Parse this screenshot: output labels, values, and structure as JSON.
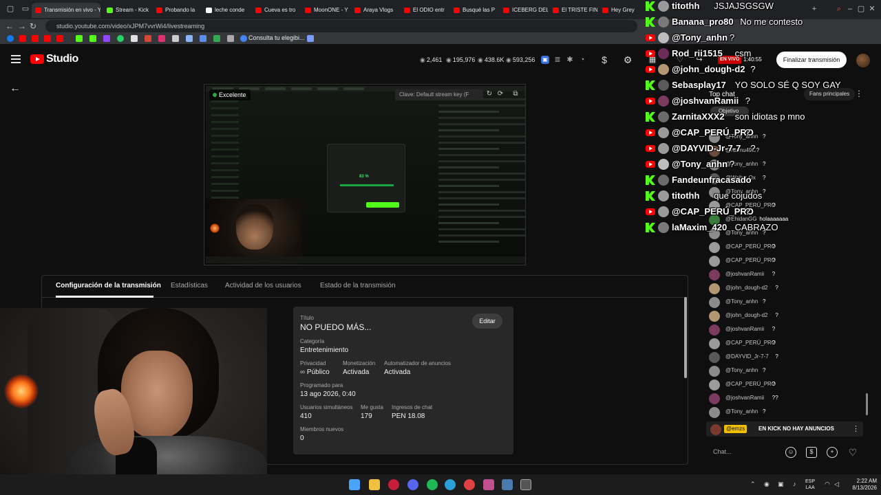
{
  "browser": {
    "tabs": [
      {
        "label": "Transmisión en vivo - Y",
        "active": true,
        "fav_color": "#ff0000"
      },
      {
        "label": "Stream - Kick",
        "active": false,
        "fav_color": "#53fc18"
      },
      {
        "label": "Probando la",
        "active": false,
        "fav_color": "#ff0000"
      },
      {
        "label": "leche conde",
        "active": false,
        "fav_color": "#ffffff"
      },
      {
        "label": "Cueva es tro",
        "active": false,
        "fav_color": "#ff0000"
      },
      {
        "label": "MoonONE - Y",
        "active": false,
        "fav_color": "#ff0000"
      },
      {
        "label": "Araya Vlogs",
        "active": false,
        "fav_color": "#ff0000"
      },
      {
        "label": "El ODIO entr",
        "active": false,
        "fav_color": "#ff0000"
      },
      {
        "label": "Busqué las P",
        "active": false,
        "fav_color": "#ff0000"
      },
      {
        "label": "ICEBERG DEL",
        "active": false,
        "fav_color": "#ff0000"
      },
      {
        "label": "El TRISTE FIN",
        "active": false,
        "fav_color": "#ff0000"
      },
      {
        "label": "Hey Grey",
        "active": false,
        "fav_color": "#ff0000"
      }
    ],
    "url": "studio.youtube.com/video/xJPM7vvrWi4/livestreaming",
    "bookmark_text": "Consulta tu elegibi..."
  },
  "header": {
    "brand": "Studio",
    "stats": [
      {
        "icon": "eye-icon",
        "value": "2,461"
      },
      {
        "icon": "eye-icon",
        "value": "195,976"
      },
      {
        "icon": "eye-icon",
        "value": "438.6K"
      },
      {
        "icon": "eye-icon",
        "value": "593,256"
      }
    ],
    "live_label": "EN VIVO",
    "live_time": "1:40:55",
    "end_button": "Finalizar transmisión"
  },
  "preview": {
    "quality": "Excelente",
    "stream_key": "Clave: Default stream key (F",
    "mini_percent": "83 %"
  },
  "tabs": [
    {
      "label": "Configuración de la transmisión",
      "active": true
    },
    {
      "label": "Estadísticas",
      "active": false
    },
    {
      "label": "Actividad de los usuarios",
      "active": false
    },
    {
      "label": "Estado de la transmisión",
      "active": false
    }
  ],
  "details": {
    "title_label": "Título",
    "title": "NO PUEDO MÁS...",
    "edit_button": "Editar",
    "category_label": "Categoría",
    "category": "Entretenimiento",
    "privacy_label": "Privacidad",
    "privacy": "Público",
    "monetization_label": "Monetización",
    "monetization": "Activada",
    "ads_label": "Automatizador de anuncios",
    "ads": "Activada",
    "scheduled_label": "Programado para",
    "scheduled": "13 ago 2026, 0:40",
    "concurrent_label": "Usuarios simultáneos",
    "concurrent": "410",
    "likes_label": "Me gusta",
    "likes": "179",
    "chat_income_label": "Ingresos de chat",
    "chat_income": "PEN 18.08",
    "new_members_label": "Miembros nuevos",
    "new_members": "0"
  },
  "chat": {
    "header": "Top chat",
    "fans_label": "Fans principales",
    "goal_label": "Objetivo",
    "messages": [
      {
        "name": "@Tony_anhn",
        "msg": "?"
      },
      {
        "name": "@Namu49C",
        "msg": "?"
      },
      {
        "name": "@Tony_anhn",
        "msg": "?"
      },
      {
        "name": "@Walter-Ox",
        "msg": "?"
      },
      {
        "name": "@Tony_anhn",
        "msg": "?"
      },
      {
        "name": "@CAP_PERÚ_PRO",
        "msg": "?"
      },
      {
        "name": "@EhidanGG",
        "msg": "holaaaaaaa"
      },
      {
        "name": "@Tony_anhn",
        "msg": "?"
      },
      {
        "name": "@CAP_PERÚ_PRO",
        "msg": "?"
      },
      {
        "name": "@CAP_PERÚ_PRO",
        "msg": "?"
      },
      {
        "name": "@joshvanRamii",
        "msg": "?"
      },
      {
        "name": "@john_dough-d2",
        "msg": "?"
      },
      {
        "name": "@Tony_anhn",
        "msg": "?"
      },
      {
        "name": "@john_dough-d2",
        "msg": "?"
      },
      {
        "name": "@joshvanRamii",
        "msg": "?"
      },
      {
        "name": "@CAP_PERÚ_PRO",
        "msg": "?"
      },
      {
        "name": "@DAYVID_Jr-7-7",
        "msg": "?"
      },
      {
        "name": "@Tony_anhn",
        "msg": "?"
      },
      {
        "name": "@CAP_PERÚ_PRO",
        "msg": "?"
      },
      {
        "name": "@joshvanRamii",
        "msg": "??"
      },
      {
        "name": "@Tony_anhn",
        "msg": "?"
      }
    ],
    "pinned_name": "@emzs",
    "pinned_msg": "EN KICK NO HAY ANUNCIOS",
    "input_placeholder": "Chat..."
  },
  "overlay": [
    {
      "platform": "kick",
      "name": "titothh",
      "msg": "JSJAJSGSGW"
    },
    {
      "platform": "kick",
      "name": "Banana_pro80",
      "msg": "No me contesto"
    },
    {
      "platform": "youtube",
      "name": "@Tony_anhn",
      "msg": "?"
    },
    {
      "platform": "youtube",
      "name": "Rod_rii1515",
      "msg": "csm"
    },
    {
      "platform": "youtube",
      "name": "@john_dough-d2",
      "msg": "?"
    },
    {
      "platform": "kick",
      "name": "Sebasplay17",
      "msg": "YO SOLO SÉ Q SOY GAY"
    },
    {
      "platform": "youtube",
      "name": "@joshvanRamii",
      "msg": "?"
    },
    {
      "platform": "kick",
      "name": "ZarnitaXXX2",
      "msg": "son idiotas p mno"
    },
    {
      "platform": "youtube",
      "name": "@CAP_PERÚ_PRO",
      "msg": "?"
    },
    {
      "platform": "youtube",
      "name": "@DAYVID-Jr-7-7",
      "msg": "?"
    },
    {
      "platform": "youtube",
      "name": "@Tony_anhn",
      "msg": "?"
    },
    {
      "platform": "kick",
      "name": "Fandeunfracasado",
      "msg": ""
    },
    {
      "platform": "kick",
      "name": "titothh",
      "msg": "que cojudos"
    },
    {
      "platform": "youtube",
      "name": "@CAP_PERÚ_PRO",
      "msg": "?"
    },
    {
      "platform": "kick",
      "name": "laMaxim_420",
      "msg": "CABRAZO"
    }
  ],
  "taskbar": {
    "lang_top": "ESP",
    "lang_bottom": "LAA",
    "time": "2:22 AM",
    "date": "8/13/2026"
  },
  "colors": {
    "accent_red": "#ff0000",
    "kick_green": "#53fc18",
    "pinned_badge": "#f0c000"
  }
}
